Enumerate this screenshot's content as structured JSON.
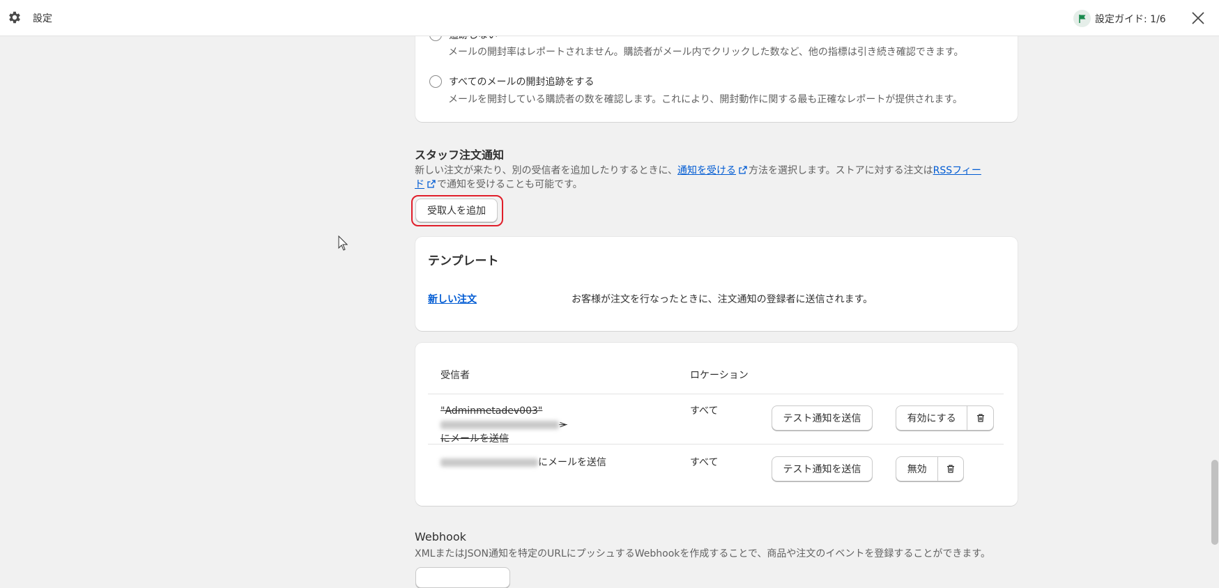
{
  "topbar": {
    "title": "設定",
    "guide_label": "設定ガイド: 1/6"
  },
  "open_tracking": {
    "option_partial_label": "追跡しない",
    "option_partial_helper": "メールの開封率はレポートされません。購読者がメール内でクリックした数など、他の指標は引き続き確認できます。",
    "option_all_label": "すべてのメールの開封追跡をする",
    "option_all_helper": "メールを開封している購読者の数を確認します。これにより、開封動作に関する最も正確なレポートが提供されます。"
  },
  "staff_notifications": {
    "title": "スタッフ注文通知",
    "desc_part1": "新しい注文が来たり、別の受信者を追加したりするときに、",
    "desc_link1": "通知を受ける",
    "desc_part2": "方法を選択します。ストアに対する注文は",
    "desc_link2a": "RSSフィー",
    "desc_link2b": "ド",
    "desc_part3": "で通知を受けることも可能です。",
    "add_recipient_label": "受取人を追加"
  },
  "templates": {
    "title": "テンプレート",
    "items": [
      {
        "name": "新しい注文",
        "description": "お客様が注文を行なったときに、注文通知の登録者に送信されます。"
      }
    ]
  },
  "recipients": {
    "col_recipient": "受信者",
    "col_location": "ロケーション",
    "rows": [
      {
        "line1": "\"Adminmetadev003\"",
        "line1_end": ">",
        "line2": "にメールを送信",
        "location": "すべて",
        "test_label": "テスト通知を送信",
        "toggle_label": "有効にする"
      },
      {
        "line1_suffix": "にメールを送信",
        "location": "すべて",
        "test_label": "テスト通知を送信",
        "toggle_label": "無効"
      }
    ]
  },
  "webhook": {
    "title": "Webhook",
    "desc": "XMLまたはJSON通知を特定のURLにプッシュするWebhookを作成することで、商品や注文のイベントを登録することができます。"
  },
  "colors": {
    "accent_link": "#005bd3",
    "highlight": "#e01e2a",
    "flag": "#1a8a4e"
  }
}
